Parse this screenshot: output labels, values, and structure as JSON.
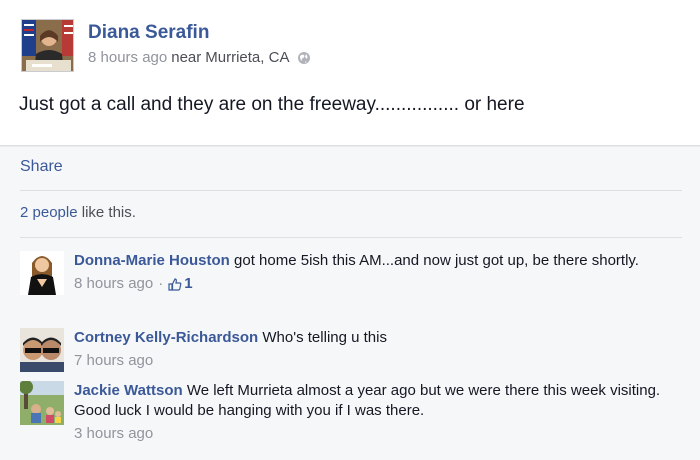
{
  "post": {
    "author": "Diana Serafin",
    "time": "8 hours ago",
    "near_word": "near",
    "location": "Murrieta, CA",
    "privacy_icon": "globe-icon",
    "text": "Just got a call and they are on the freeway................ or here"
  },
  "actions": {
    "share": "Share"
  },
  "likes": {
    "people": "2 people",
    "suffix": "like this."
  },
  "comments": [
    {
      "name": "Donna-Marie Houston",
      "text": "got home 5ish this AM...and now just got up, be there shortly.",
      "time": "8 hours ago",
      "like_icon": "thumbs-up-icon",
      "likes": "1"
    },
    {
      "name": "Cortney Kelly-Richardson",
      "text": "Who's telling u this",
      "time": "7 hours ago"
    },
    {
      "name": "Jackie Wattson",
      "text": "We left Murrieta almost a year ago but we were there this week visiting. Good luck I would be hanging with you if I was there.",
      "time": "3 hours ago"
    }
  ],
  "colors": {
    "link": "#3b5998",
    "meta": "#90949c",
    "panel": "#f6f7f9"
  }
}
